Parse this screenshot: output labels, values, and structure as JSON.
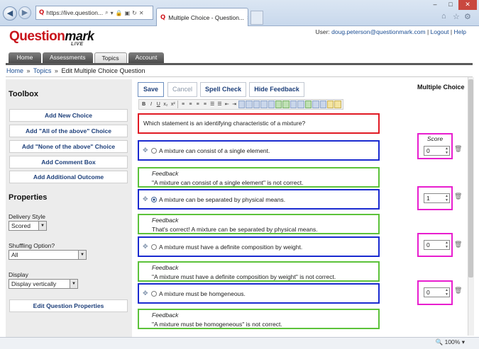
{
  "browser": {
    "address": "https://live.question...",
    "tab_title": "Multiple Choice - Question...",
    "close": "×",
    "zoom": "100%"
  },
  "header": {
    "logo_main": "Question",
    "logo_mark": "mark",
    "logo_sub": "LIVE",
    "user_label": "User:",
    "user_email": "doug.peterson@questionmark.com",
    "logout": "Logout",
    "help": "Help",
    "sep": "|"
  },
  "nav_tabs": [
    {
      "label": "Home"
    },
    {
      "label": "Assessments"
    },
    {
      "label": "Topics"
    },
    {
      "label": "Account"
    }
  ],
  "breadcrumb": {
    "home": "Home",
    "topics": "Topics",
    "current": "Edit Multiple Choice Question",
    "sep": "»"
  },
  "toolbox": {
    "title": "Toolbox",
    "buttons": [
      {
        "label": "Add New Choice"
      },
      {
        "label": "Add \"All of the above\" Choice"
      },
      {
        "label": "Add \"None of the above\" Choice"
      },
      {
        "label": "Add Comment Box"
      },
      {
        "label": "Add Additional Outcome"
      }
    ]
  },
  "properties": {
    "title": "Properties",
    "delivery_label": "Delivery Style",
    "delivery_value": "Scored",
    "shuffling_label": "Shuffling Option?",
    "shuffling_value": "All",
    "display_label": "Display",
    "display_value": "Display vertically",
    "edit_button": "Edit Question Properties"
  },
  "toolbar": {
    "save": "Save",
    "cancel": "Cancel",
    "spell_check": "Spell Check",
    "hide_feedback": "Hide Feedback",
    "question_type": "Multiple Choice"
  },
  "format_buttons": [
    "B",
    "I",
    "U",
    "x₂",
    "x²",
    "≡",
    "≡",
    "≡",
    "≡",
    "☰",
    "☰",
    "⇤",
    "⇥"
  ],
  "question": {
    "text": "Which statement is an identifying characteristic of a mixture?"
  },
  "score_header": "Score",
  "choices": [
    {
      "text": "A mixture can consist of a single element.",
      "checked": false,
      "score": "0",
      "feedback": "\"A mixture can consist of a single element\" is not correct."
    },
    {
      "text": "A mixture can be separated by physical means.",
      "checked": true,
      "score": "1",
      "feedback": "That's correct! A mixture can be separated by physical means."
    },
    {
      "text": "A mixture must have a definite composition by weight.",
      "checked": false,
      "score": "0",
      "feedback": "\"A mixture must have a definite composition by weight\" is not correct."
    },
    {
      "text": "A mixture must be homgeneous.",
      "checked": false,
      "score": "0",
      "feedback": "\"A mixture must be homogeneous\" is not correct."
    }
  ],
  "feedback_label": "Feedback",
  "colors": {
    "question_border": "#e01a24",
    "choice_border": "#1a2bd0",
    "feedback_border": "#5cc23a",
    "score_border": "#e81ecf"
  }
}
